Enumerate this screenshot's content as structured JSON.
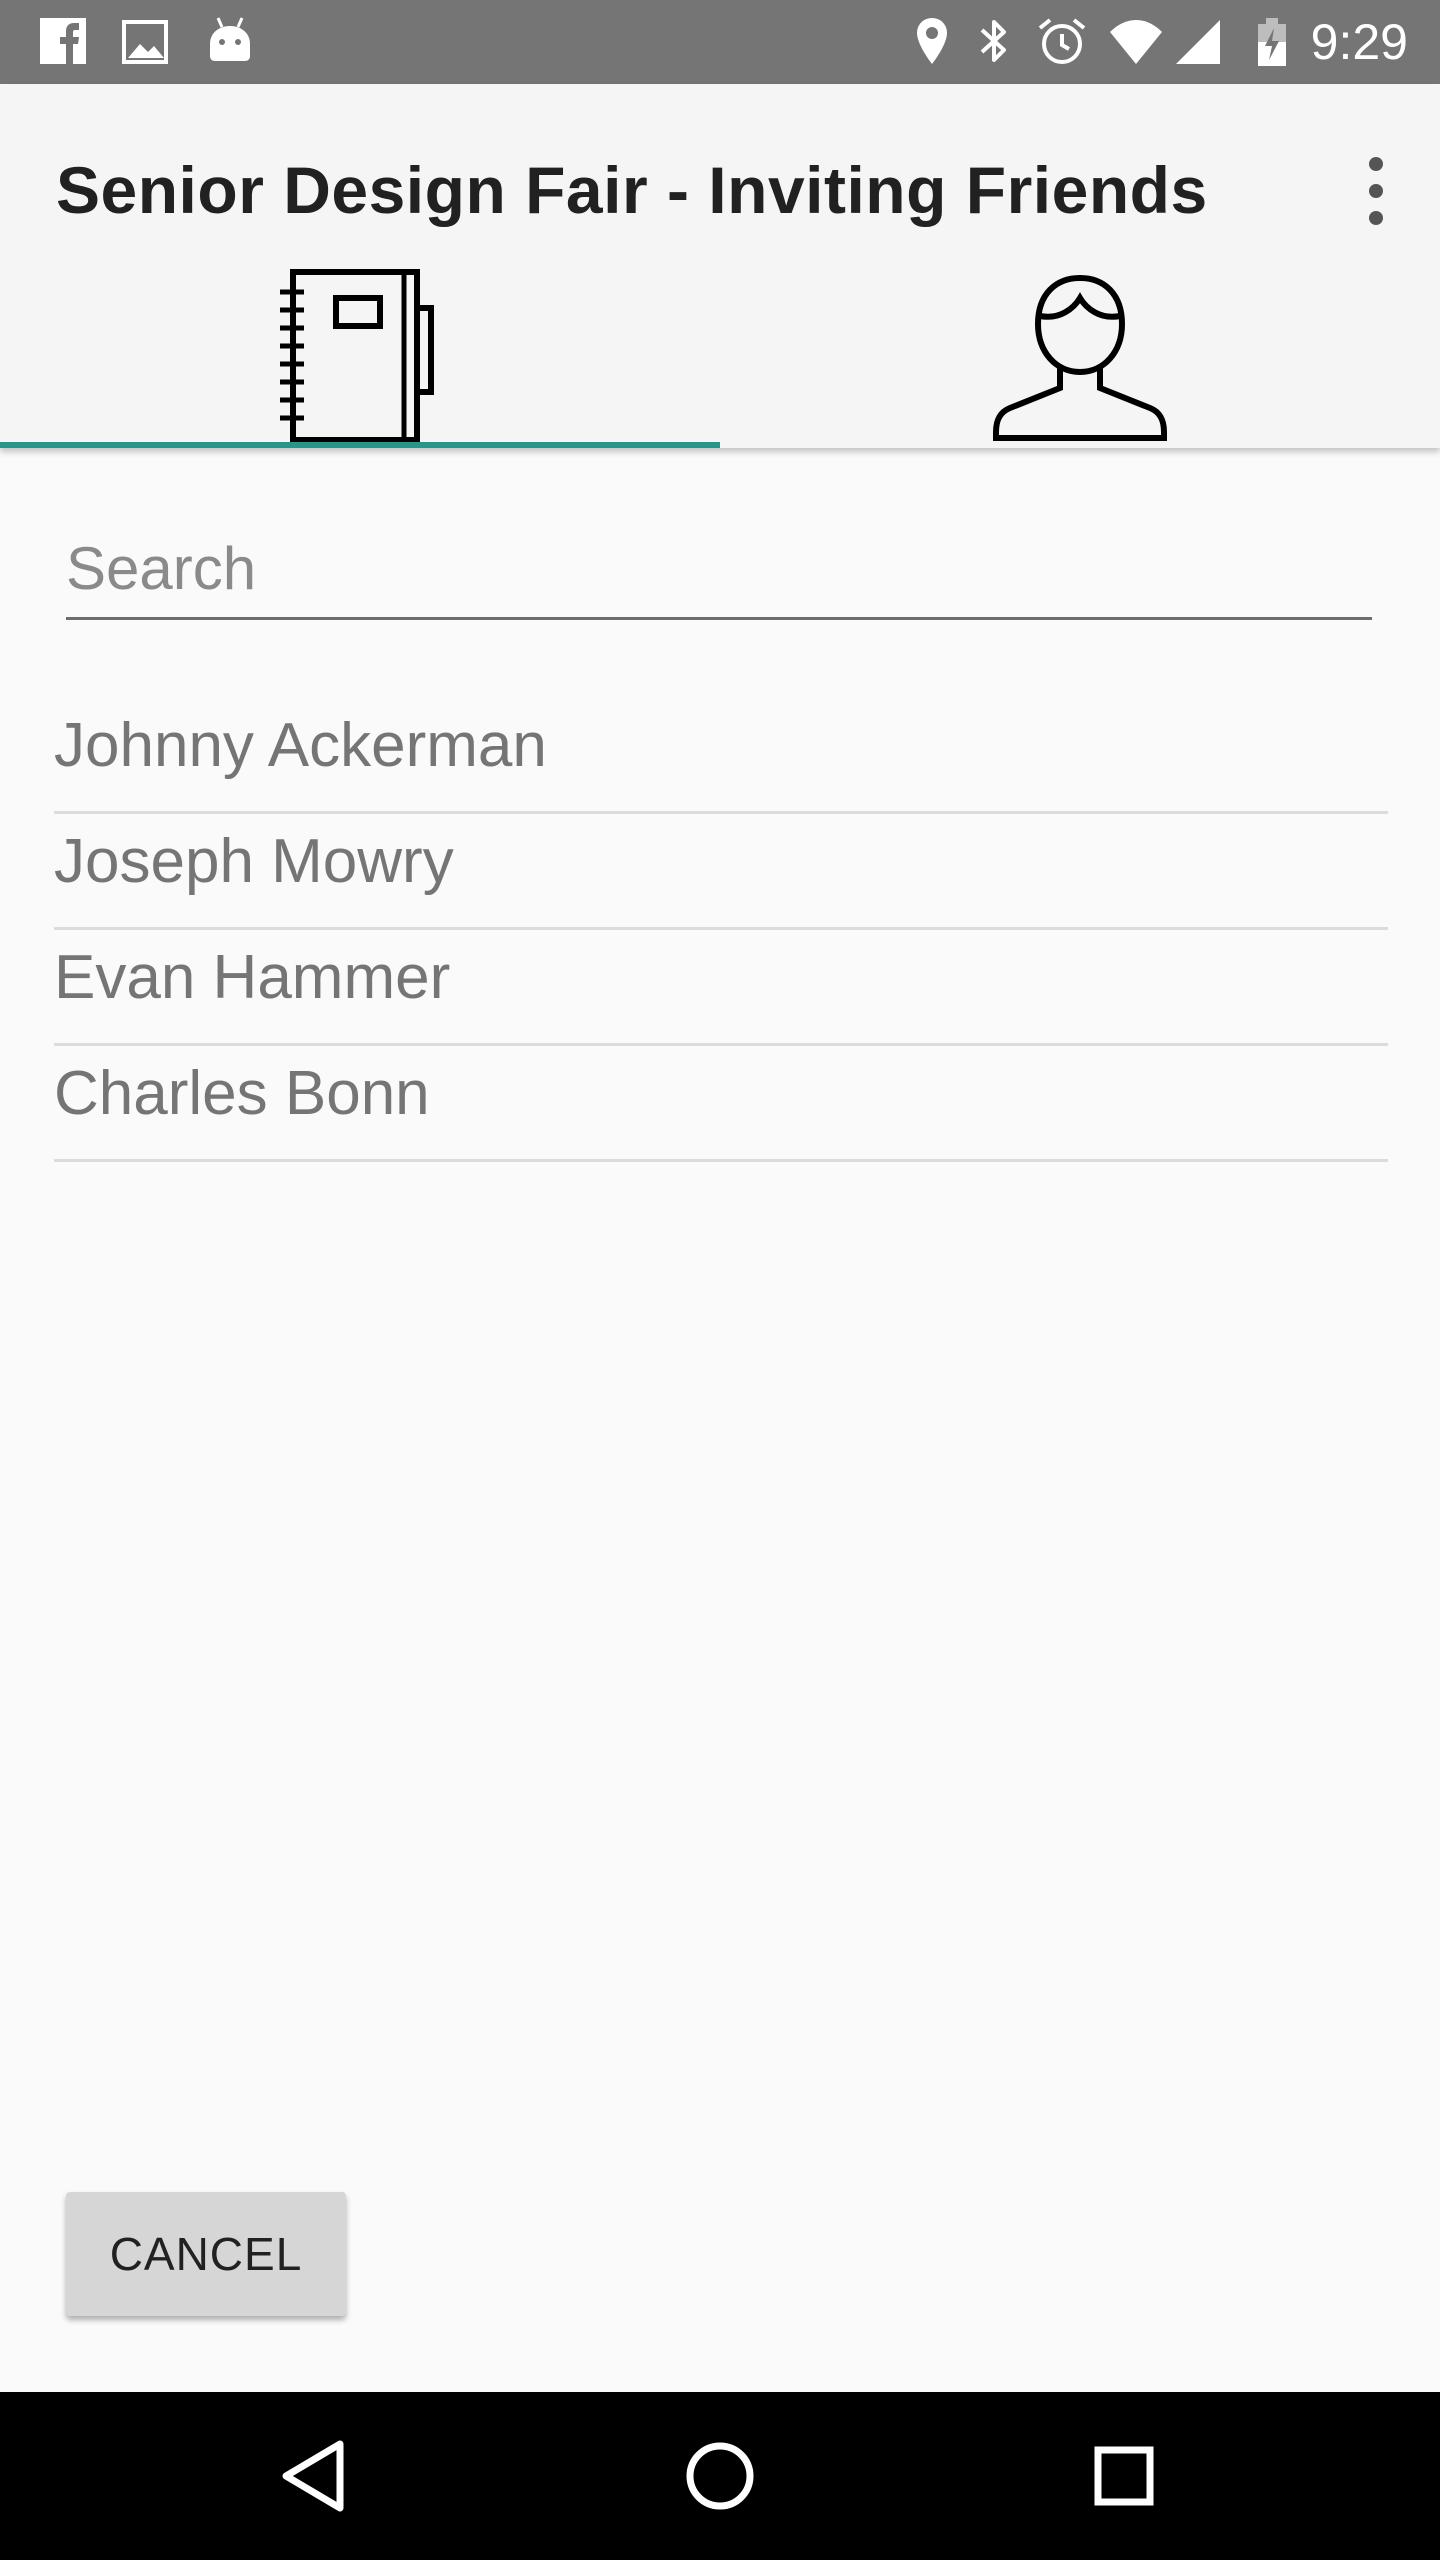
{
  "status_bar": {
    "time": "9:29",
    "left_icons": [
      "facebook-icon",
      "image-icon",
      "android-icon"
    ],
    "right_icons": [
      "location-icon",
      "bluetooth-icon",
      "alarm-icon",
      "wifi-icon",
      "signal-icon",
      "battery-icon"
    ]
  },
  "app_bar": {
    "title": "Senior Design Fair - Inviting Friends",
    "menu_icon": "more-vert-icon"
  },
  "tabs": [
    {
      "icon": "notebook-icon",
      "selected": true
    },
    {
      "icon": "person-icon",
      "selected": false
    }
  ],
  "colors": {
    "accent": "#26968a",
    "status_bar": "#757575",
    "app_bar": "#f5f5f5"
  },
  "search": {
    "placeholder": "Search",
    "value": ""
  },
  "friends": [
    {
      "name": "Johnny Ackerman"
    },
    {
      "name": "Joseph Mowry"
    },
    {
      "name": "Evan Hammer"
    },
    {
      "name": "Charles Bonn"
    }
  ],
  "actions": {
    "cancel_label": "CANCEL"
  },
  "nav_bar": {
    "buttons": [
      "back-icon",
      "home-icon",
      "recents-icon"
    ]
  }
}
